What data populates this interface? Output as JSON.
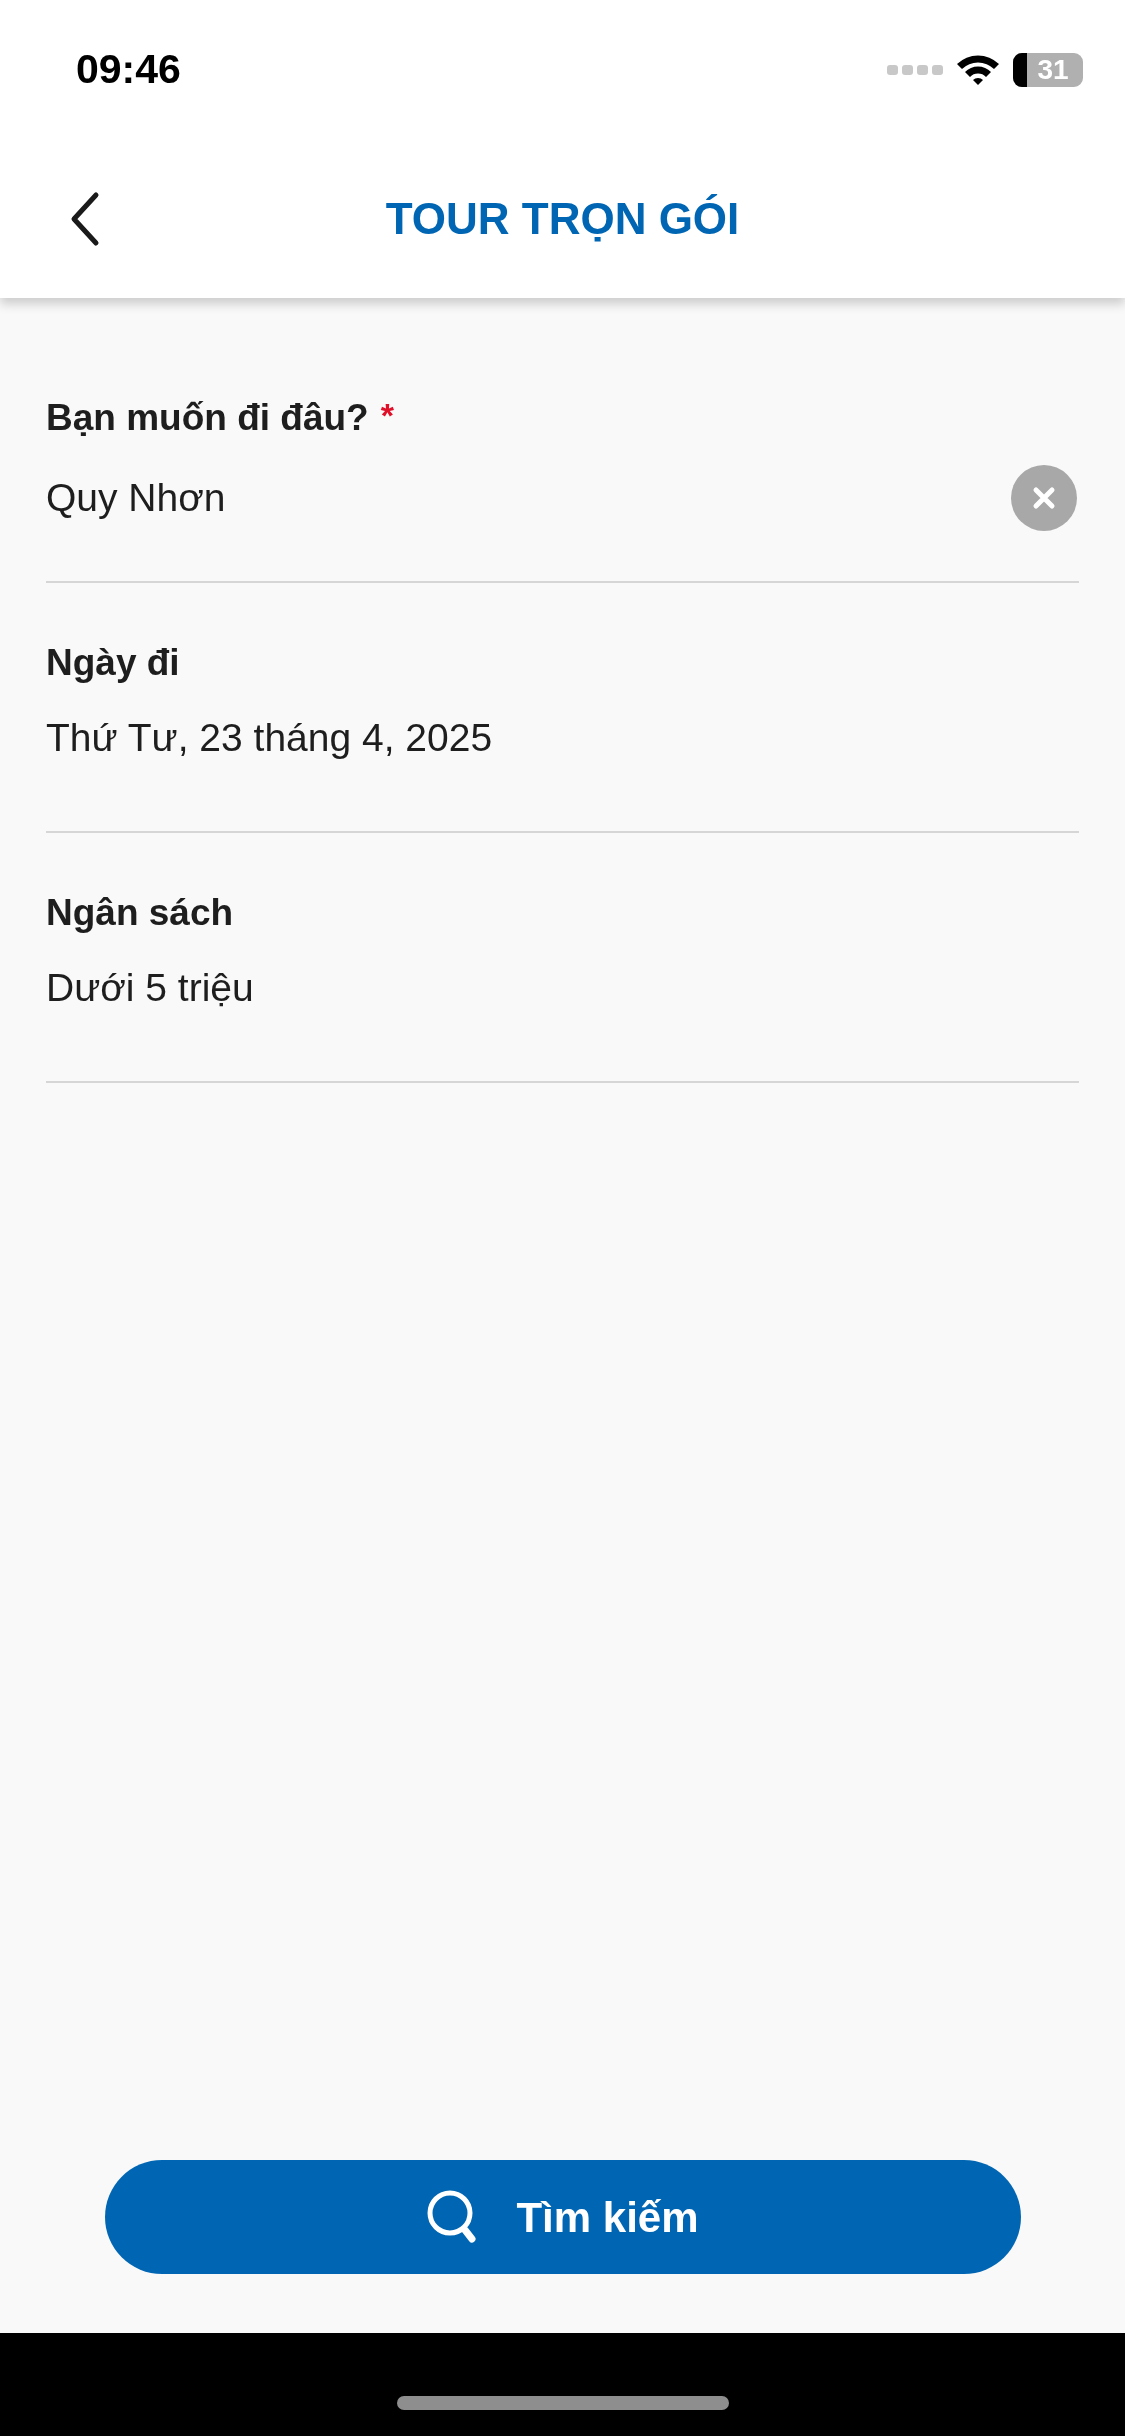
{
  "status_bar": {
    "time": "09:46",
    "battery": "31"
  },
  "header": {
    "title": "TOUR TRỌN GÓI"
  },
  "fields": [
    {
      "label": "Bạn muốn đi đâu?",
      "required_mark": "*",
      "value": "Quy Nhơn",
      "clearable": true
    },
    {
      "label": "Ngày đi",
      "value": "Thứ Tư, 23 tháng 4, 2025",
      "clearable": false
    },
    {
      "label": "Ngân sách",
      "value": "Dưới 5 triệu",
      "clearable": false
    }
  ],
  "search_button": {
    "label": "Tìm kiếm"
  }
}
